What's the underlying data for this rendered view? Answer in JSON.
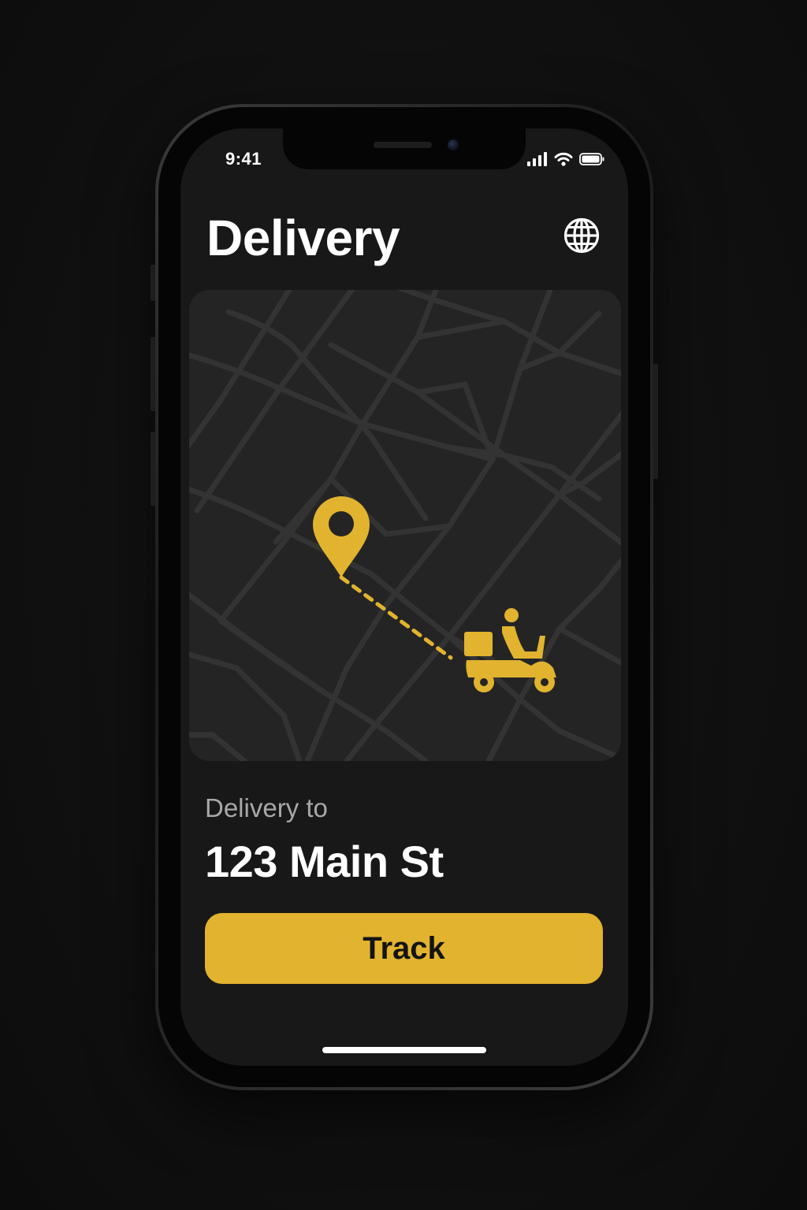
{
  "status_bar": {
    "time": "9:41",
    "icons": [
      "cellular-signal-icon",
      "wifi-icon",
      "battery-icon"
    ]
  },
  "header": {
    "title": "Delivery",
    "action_icon": "globe-icon"
  },
  "map": {
    "destination_icon": "location-pin-icon",
    "courier_icon": "scooter-courier-icon",
    "route_style": "dotted"
  },
  "delivery": {
    "label": "Delivery to",
    "address": "123 Main St"
  },
  "track_button": {
    "label": "Track"
  },
  "colors": {
    "accent": "#E1B32F",
    "background": "#181818",
    "map_background": "#242424",
    "map_roads": "#333333",
    "text_primary": "#FFFFFF",
    "text_secondary": "#A8A8A8"
  }
}
